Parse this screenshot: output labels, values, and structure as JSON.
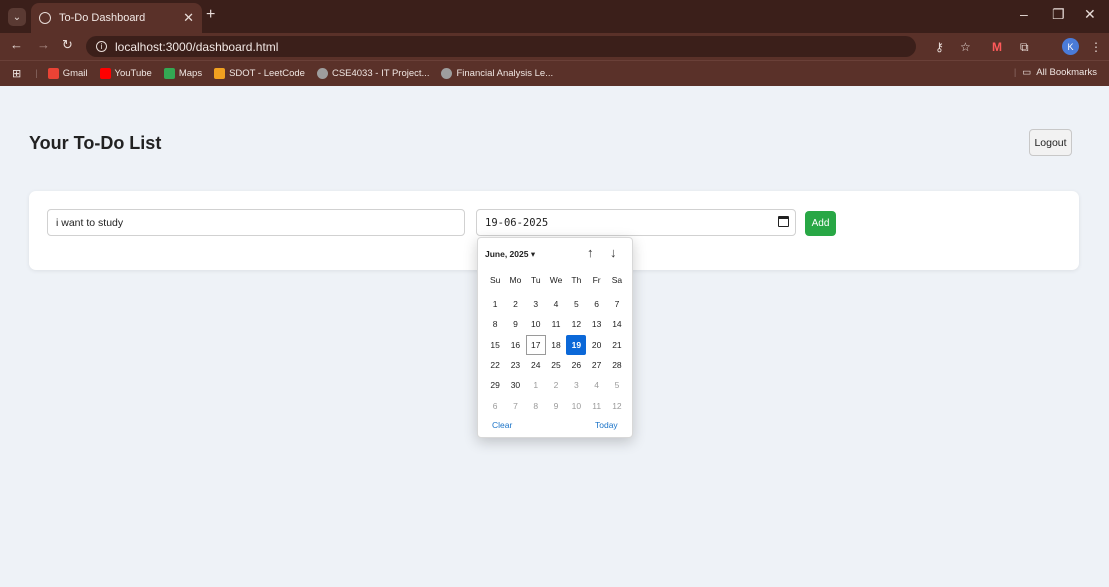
{
  "browser": {
    "tab_title": "To-Do Dashboard",
    "url": "localhost:3000/dashboard.html",
    "bookmarks": [
      {
        "label": "Gmail",
        "color": "#ea4335"
      },
      {
        "label": "YouTube",
        "color": "#ff0000"
      },
      {
        "label": "Maps",
        "color": "#34a853"
      },
      {
        "label": "SDOT - LeetCode",
        "color": "#f0a020"
      },
      {
        "label": "CSE4033 - IT Project...",
        "color": "#9e9e9e"
      },
      {
        "label": "Financial Analysis Le...",
        "color": "#9e9e9e"
      }
    ],
    "all_bookmarks": "All Bookmarks",
    "profile_initial": "K"
  },
  "page": {
    "title": "Your To-Do List",
    "logout_label": "Logout",
    "task_value": "i want to study",
    "date_value": "19-06-2025",
    "add_label": "Add"
  },
  "picker": {
    "month_label": "June, 2025 ▾",
    "weekdays": [
      "Su",
      "Mo",
      "Tu",
      "We",
      "Th",
      "Fr",
      "Sa"
    ],
    "days": [
      {
        "d": "1",
        "m": "cur"
      },
      {
        "d": "2",
        "m": "cur"
      },
      {
        "d": "3",
        "m": "cur"
      },
      {
        "d": "4",
        "m": "cur"
      },
      {
        "d": "5",
        "m": "cur"
      },
      {
        "d": "6",
        "m": "cur"
      },
      {
        "d": "7",
        "m": "cur"
      },
      {
        "d": "8",
        "m": "cur"
      },
      {
        "d": "9",
        "m": "cur"
      },
      {
        "d": "10",
        "m": "cur"
      },
      {
        "d": "11",
        "m": "cur"
      },
      {
        "d": "12",
        "m": "cur"
      },
      {
        "d": "13",
        "m": "cur"
      },
      {
        "d": "14",
        "m": "cur"
      },
      {
        "d": "15",
        "m": "cur"
      },
      {
        "d": "16",
        "m": "cur"
      },
      {
        "d": "17",
        "m": "today"
      },
      {
        "d": "18",
        "m": "cur"
      },
      {
        "d": "19",
        "m": "selected"
      },
      {
        "d": "20",
        "m": "cur"
      },
      {
        "d": "21",
        "m": "cur"
      },
      {
        "d": "22",
        "m": "cur"
      },
      {
        "d": "23",
        "m": "cur"
      },
      {
        "d": "24",
        "m": "cur"
      },
      {
        "d": "25",
        "m": "cur"
      },
      {
        "d": "26",
        "m": "cur"
      },
      {
        "d": "27",
        "m": "cur"
      },
      {
        "d": "28",
        "m": "cur"
      },
      {
        "d": "29",
        "m": "cur"
      },
      {
        "d": "30",
        "m": "cur"
      },
      {
        "d": "1",
        "m": "other"
      },
      {
        "d": "2",
        "m": "other"
      },
      {
        "d": "3",
        "m": "other"
      },
      {
        "d": "4",
        "m": "other"
      },
      {
        "d": "5",
        "m": "other"
      },
      {
        "d": "6",
        "m": "other"
      },
      {
        "d": "7",
        "m": "other"
      },
      {
        "d": "8",
        "m": "other"
      },
      {
        "d": "9",
        "m": "other"
      },
      {
        "d": "10",
        "m": "other"
      },
      {
        "d": "11",
        "m": "other"
      },
      {
        "d": "12",
        "m": "other"
      }
    ],
    "clear_label": "Clear",
    "today_label": "Today"
  }
}
